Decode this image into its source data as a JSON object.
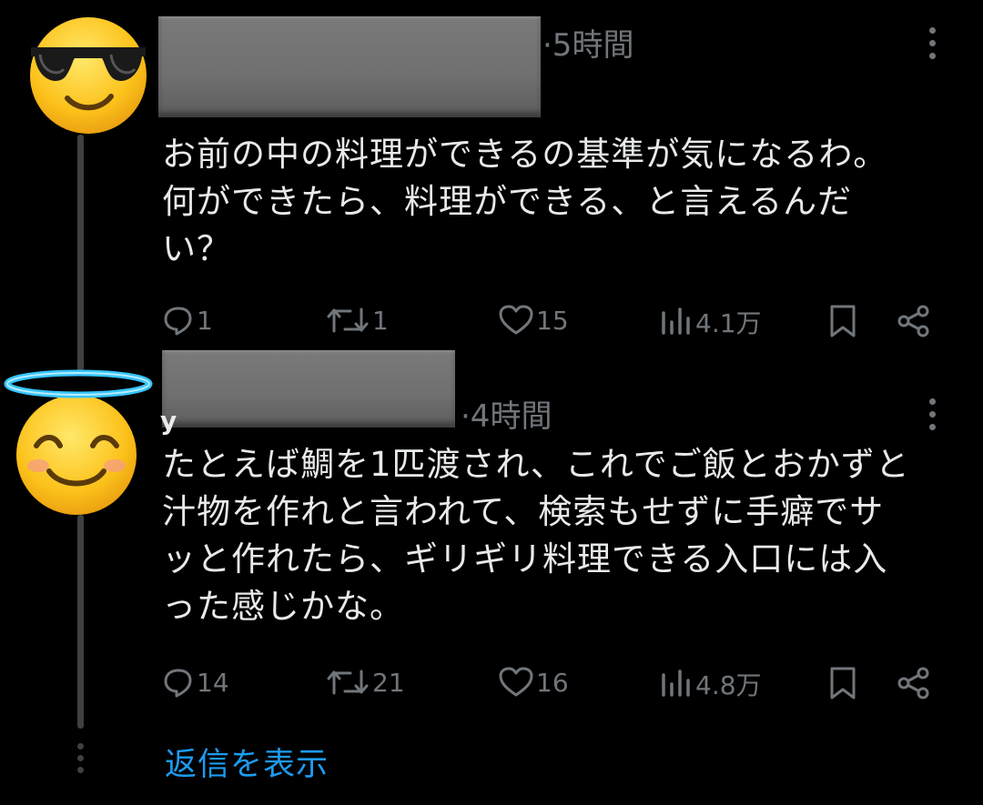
{
  "tweets": [
    {
      "name_fragment": "",
      "time": "·5時間",
      "text": [
        "お前の中の料理ができるの基準が気になるわ。",
        "何ができたら、料理ができる、と言えるんだ",
        "い？"
      ],
      "avatar_icon": "sunglasses-face-emoji",
      "stats": {
        "replies": "1",
        "retweets": "1",
        "likes": "15",
        "views": "4.1万"
      }
    },
    {
      "name_fragment": "y",
      "time": "·4時間",
      "text": [
        "たとえば鯛を1匹渡され、これでご飯とおかずと",
        "汁物を作れと言われて、検索もせずに手癖でサ",
        "ッと作れたら、ギリギリ料理できる入口には入",
        "った感じかな。"
      ],
      "avatar_icon": "halo-smiling-face-emoji",
      "stats": {
        "replies": "14",
        "retweets": "21",
        "likes": "16",
        "views": "4.8万"
      }
    }
  ],
  "show_replies": "返信を表示",
  "colors": {
    "background": "#000000",
    "text": "#e7e9ea",
    "muted": "#71767b",
    "link": "#1d9bf0",
    "thread": "#3e4144"
  }
}
